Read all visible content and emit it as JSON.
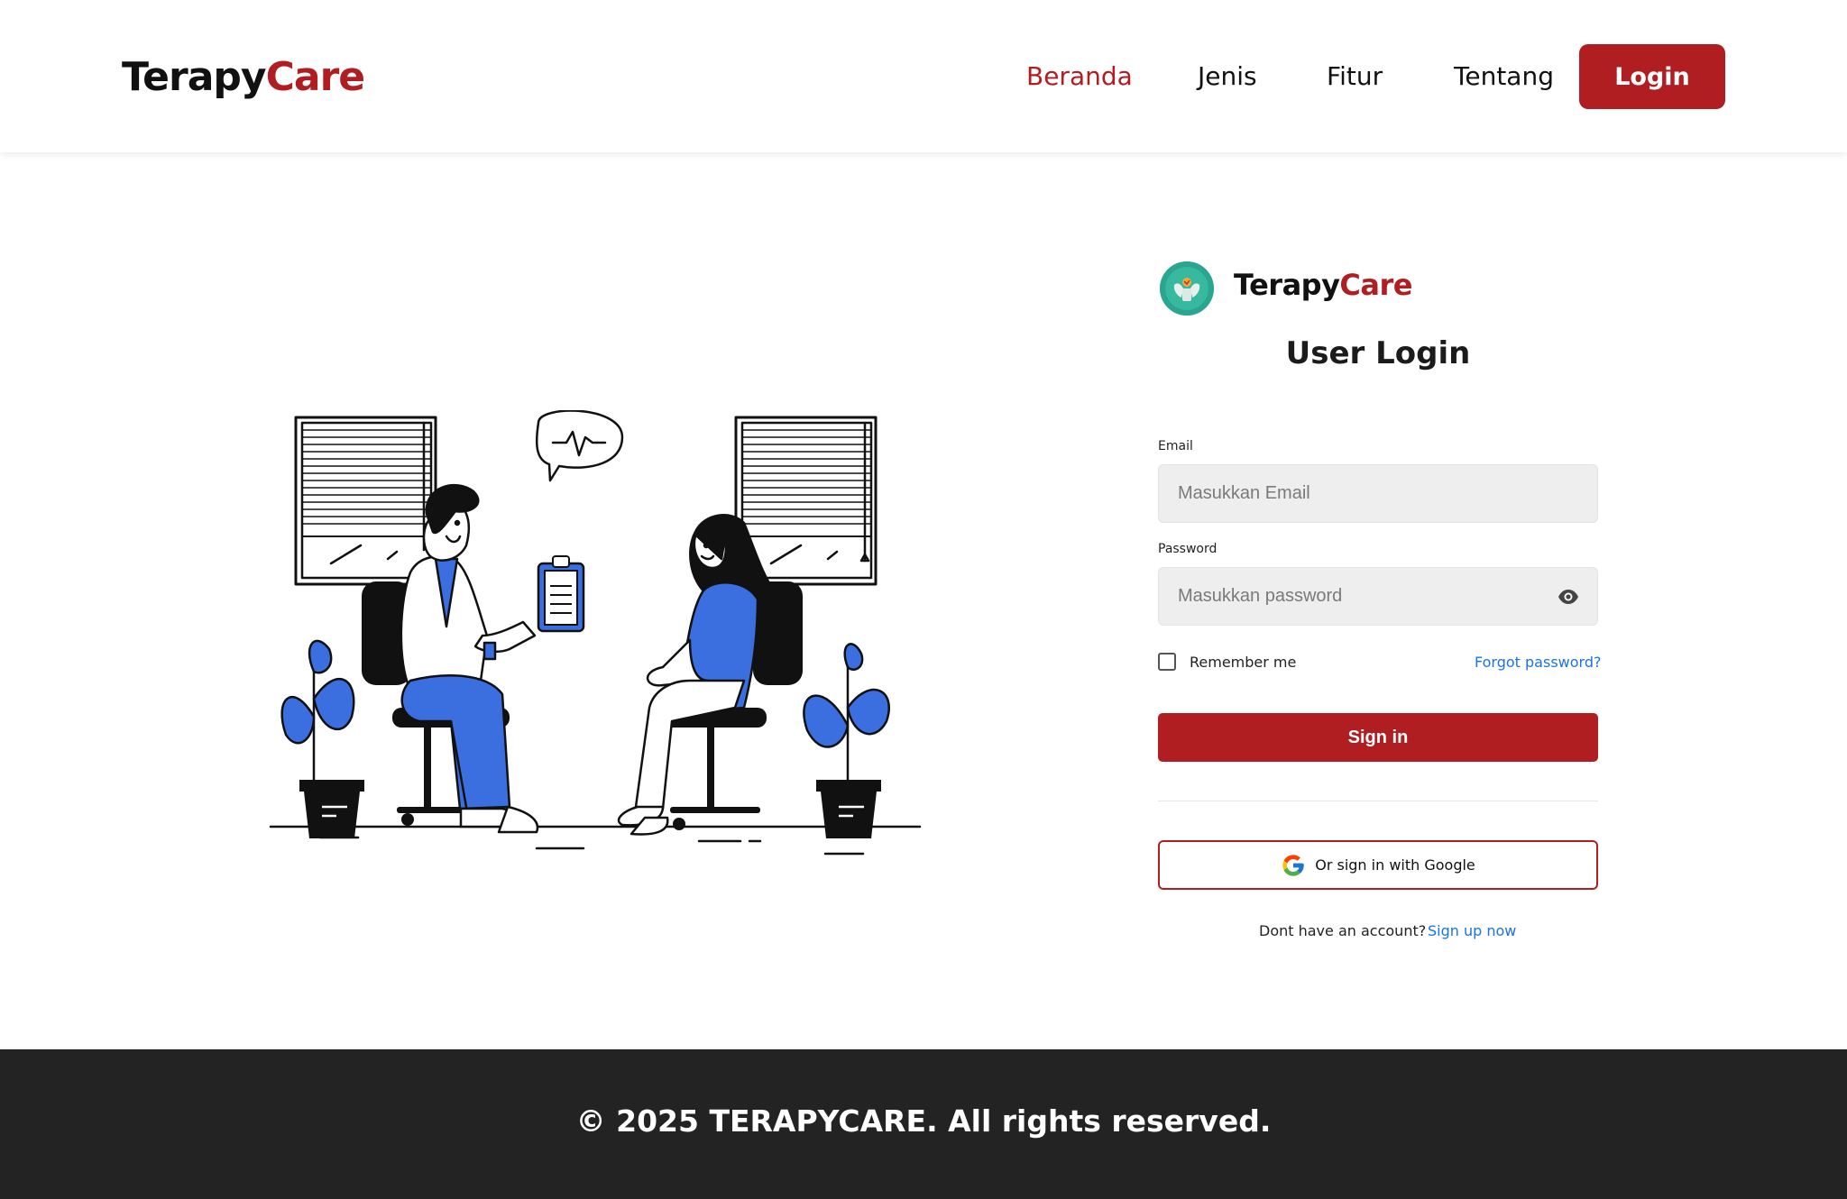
{
  "nav": {
    "brand_part1": "Terapy",
    "brand_part2": "Care",
    "links": [
      "Beranda",
      "Jenis",
      "Fitur",
      "Tentang"
    ],
    "login_label": "Login"
  },
  "form": {
    "brand_part1": "Terapy",
    "brand_part2": "Care",
    "title": "User Login",
    "email_label": "Email",
    "email_placeholder": "Masukkan Email",
    "password_label": "Password",
    "password_placeholder": "Masukkan password",
    "remember_label": "Remember me",
    "forgot_label": "Forgot password?",
    "signin_label": "Sign in",
    "google_label": "Or sign in with Google",
    "signup_text": "Dont have an account?",
    "signup_link": "Sign up now"
  },
  "footer": {
    "copyright": "© 2025 TERAPYCARE. All rights reserved."
  },
  "colors": {
    "accent": "#b01e22",
    "link": "#1a73e8",
    "illustration_blue": "#3b6fe0",
    "footer_bg": "#232323"
  },
  "icons": {
    "eye": "eye-icon",
    "google": "google-icon",
    "logo": "terapycare-logo-icon"
  }
}
